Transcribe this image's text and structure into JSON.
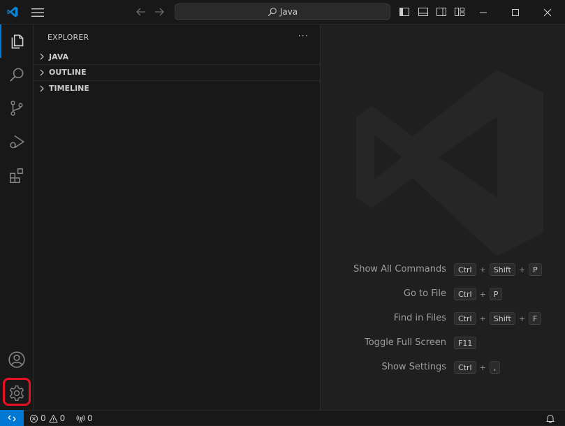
{
  "titlebar": {
    "search_text": "Java",
    "icons": [
      "vscode-logo-icon",
      "menu-icon",
      "back-arrow-icon",
      "forward-arrow-icon",
      "search-icon",
      "toggle-primary-sidebar-icon",
      "toggle-panel-icon",
      "toggle-secondary-sidebar-icon",
      "customize-layout-icon",
      "minimize-icon",
      "maximize-icon",
      "close-icon"
    ],
    "accent": "#0078d4"
  },
  "activitybar": {
    "items": [
      {
        "name": "explorer",
        "icon": "files-icon",
        "active": true
      },
      {
        "name": "search",
        "icon": "search-icon"
      },
      {
        "name": "source-control",
        "icon": "source-control-icon"
      },
      {
        "name": "run-debug",
        "icon": "run-debug-icon"
      },
      {
        "name": "extensions",
        "icon": "extensions-icon"
      }
    ],
    "bottom": [
      {
        "name": "accounts",
        "icon": "account-icon"
      },
      {
        "name": "manage",
        "icon": "gear-icon",
        "highlighted": true
      }
    ],
    "highlight_color": "#e81123"
  },
  "sidebar": {
    "title": "EXPLORER",
    "more": "···",
    "sections": [
      {
        "label": "JAVA"
      },
      {
        "label": "OUTLINE"
      },
      {
        "label": "TIMELINE"
      }
    ]
  },
  "editor": {
    "shortcuts": [
      {
        "label": "Show All Commands",
        "keys": [
          "Ctrl",
          "Shift",
          "P"
        ]
      },
      {
        "label": "Go to File",
        "keys": [
          "Ctrl",
          "P"
        ]
      },
      {
        "label": "Find in Files",
        "keys": [
          "Ctrl",
          "Shift",
          "F"
        ]
      },
      {
        "label": "Toggle Full Screen",
        "keys": [
          "F11"
        ]
      },
      {
        "label": "Show Settings",
        "keys": [
          "Ctrl",
          ","
        ]
      }
    ]
  },
  "statusbar": {
    "errors": "0",
    "warnings": "0",
    "ports": "0"
  }
}
